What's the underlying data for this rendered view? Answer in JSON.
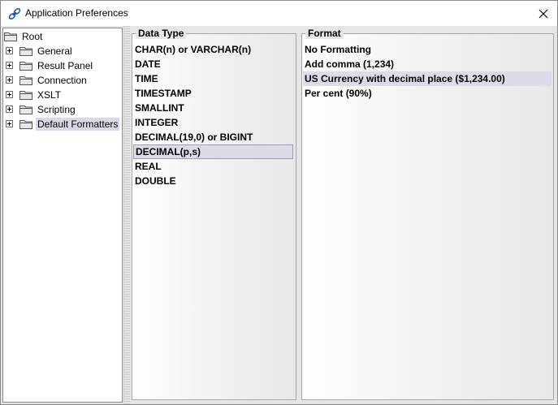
{
  "window": {
    "title": "Application Preferences"
  },
  "tree": {
    "root": "Root",
    "items": [
      {
        "label": "General"
      },
      {
        "label": "Result Panel"
      },
      {
        "label": "Connection"
      },
      {
        "label": "XSLT"
      },
      {
        "label": "Scripting"
      },
      {
        "label": "Default Formatters",
        "selected": true
      }
    ]
  },
  "data_type_panel": {
    "title": "Data Type",
    "items": [
      "CHAR(n) or VARCHAR(n)",
      "DATE",
      "TIME",
      "TIMESTAMP",
      "SMALLINT",
      "INTEGER",
      "DECIMAL(19,0) or BIGINT",
      "DECIMAL(p,s)",
      "REAL",
      "DOUBLE"
    ],
    "selected_index": 7
  },
  "format_panel": {
    "title": "Format",
    "items": [
      "No Formatting",
      "Add comma (1,234)",
      "US Currency with decimal place ($1,234.00)",
      "Per cent (90%)"
    ],
    "selected_index": 2
  },
  "colors": {
    "selection": "#dcdce8",
    "folder": "#e8e8e8",
    "background": "#e6e6e6"
  }
}
